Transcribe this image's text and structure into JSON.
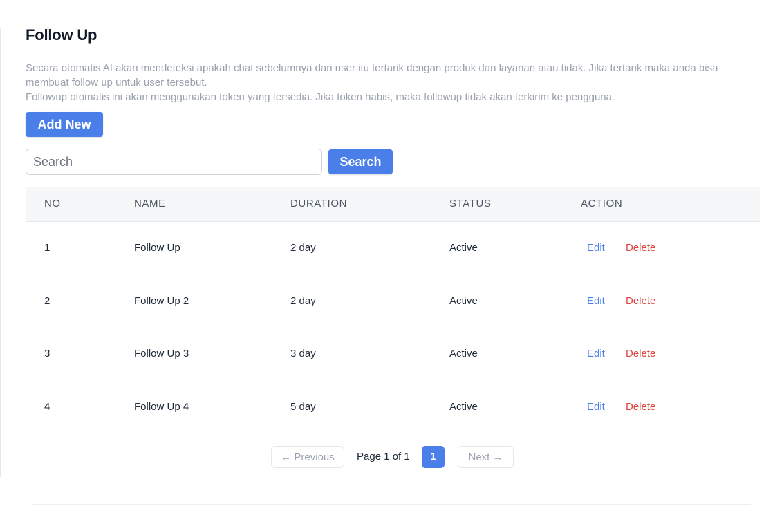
{
  "page": {
    "title": "Follow Up",
    "description_line1": "Secara otomatis AI akan mendeteksi apakah chat sebelumnya dari user itu tertarik dengan produk dan layanan atau tidak. Jika tertarik maka anda bisa membuat follow up untuk user tersebut.",
    "description_line2": "Followup otomatis ini akan menggunakan token yang tersedia. Jika token habis, maka followup tidak akan terkirim ke pengguna."
  },
  "toolbar": {
    "add_new_label": "Add New",
    "search_placeholder": "Search",
    "search_value": "",
    "search_button_label": "Search"
  },
  "table": {
    "headers": {
      "no": "NO",
      "name": "NAME",
      "duration": "DURATION",
      "status": "STATUS",
      "action": "ACTION"
    },
    "rows": [
      {
        "no": "1",
        "name": "Follow Up",
        "duration": "2 day",
        "status": "Active",
        "edit": "Edit",
        "delete": "Delete"
      },
      {
        "no": "2",
        "name": "Follow Up 2",
        "duration": "2 day",
        "status": "Active",
        "edit": "Edit",
        "delete": "Delete"
      },
      {
        "no": "3",
        "name": "Follow Up 3",
        "duration": "3 day",
        "status": "Active",
        "edit": "Edit",
        "delete": "Delete"
      },
      {
        "no": "4",
        "name": "Follow Up 4",
        "duration": "5 day",
        "status": "Active",
        "edit": "Edit",
        "delete": "Delete"
      }
    ]
  },
  "pagination": {
    "previous_label": "← Previous",
    "page_info": "Page 1 of 1",
    "current_page": "1",
    "next_label": "Next →"
  },
  "colors": {
    "primary": "#4a7fea",
    "danger": "#e0443e",
    "muted_text": "#9aa1ad",
    "header_bg": "#f6f7f9"
  }
}
